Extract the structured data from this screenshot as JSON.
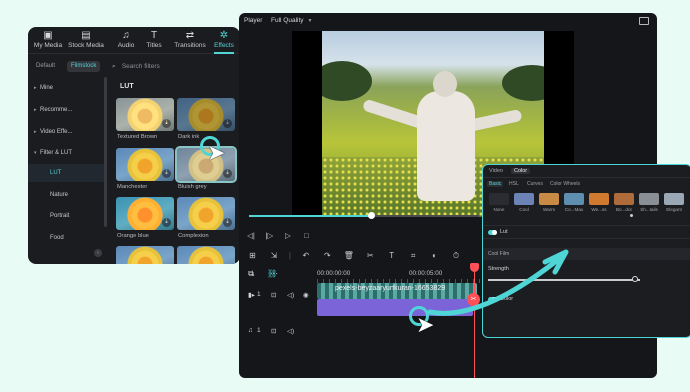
{
  "effects_panel": {
    "tabs": [
      {
        "label": "My Media",
        "icon": "folder-icon"
      },
      {
        "label": "Stock Media",
        "icon": "stock-icon"
      },
      {
        "label": "Audio",
        "icon": "music-icon"
      },
      {
        "label": "Titles",
        "icon": "titles-icon"
      },
      {
        "label": "Transitions",
        "icon": "transitions-icon"
      },
      {
        "label": "Effects",
        "icon": "effects-icon",
        "active": true
      }
    ],
    "source_tabs": [
      "Default",
      "Filmstock"
    ],
    "search_placeholder": "Search filters",
    "sidebar": [
      {
        "label": "Mine"
      },
      {
        "label": "Recomme..."
      },
      {
        "label": "Video Effe..."
      },
      {
        "label": "Filter & LUT"
      },
      {
        "label": "LUT",
        "current": true
      },
      {
        "label": "Nature"
      },
      {
        "label": "Portrait"
      },
      {
        "label": "Food"
      }
    ],
    "section_title": "LUT",
    "filters": [
      {
        "label": "Textured Brown"
      },
      {
        "label": "Dark ink"
      },
      {
        "label": "Manchester"
      },
      {
        "label": "Bluish grey",
        "selected": true
      },
      {
        "label": "Orange blue"
      },
      {
        "label": "Complexion"
      }
    ]
  },
  "editor": {
    "player_label": "Player",
    "quality": "Full Quality",
    "timecode_start": "00:00:00:00",
    "timecode_mark": "00:00:05:00",
    "clip_name": "pexels-beyzaaryurtkuran-16653829",
    "video_track_label": "1",
    "audio_track_label": "1",
    "scrub_progress": 0.53
  },
  "color_panel": {
    "tabs": [
      "Video",
      "Color"
    ],
    "active_tab": "Color",
    "subtabs": [
      "Basic",
      "HSL",
      "Curves",
      "Color Wheels"
    ],
    "presets": [
      {
        "label": "None",
        "color": "#2b2c31"
      },
      {
        "label": "Cool",
        "color": "#6c83b8"
      },
      {
        "label": "Warm",
        "color": "#c98a46"
      },
      {
        "label": "Co...Max",
        "color": "#5f8fb0"
      },
      {
        "label": "We...ss",
        "color": "#d07a2f"
      },
      {
        "label": "Bo...dor",
        "color": "#b06b3b"
      },
      {
        "label": "Sh...tails",
        "color": "#8a8f95"
      },
      {
        "label": "Elegant",
        "color": "#9aa7b5"
      }
    ],
    "lut_label": "Lut",
    "cool_film_label": "Cool Film",
    "strength_label": "Strength",
    "color_label": "Color",
    "strength_value": 0.97
  },
  "accent": "#4fd5d5",
  "playhead_color": "#ff5057",
  "color_clip": "#7b63d8"
}
